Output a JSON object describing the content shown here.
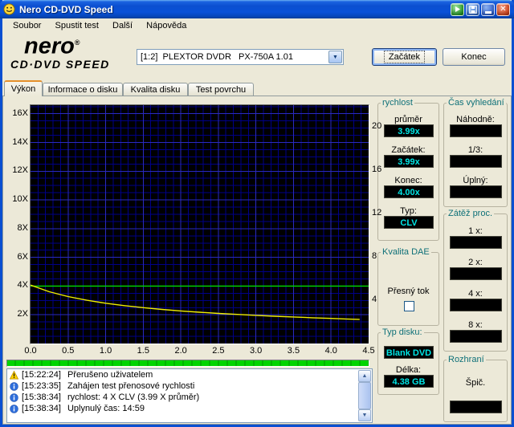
{
  "titlebar": {
    "title": "Nero CD-DVD Speed"
  },
  "icons": {
    "close": "✕",
    "dropdown": "▼",
    "scroll_up": "▲",
    "scroll_down": "▼"
  },
  "menubar": {
    "items": [
      "Soubor",
      "Spustit test",
      "Další",
      "Nápověda"
    ]
  },
  "header": {
    "logo_top": "nero",
    "logo_reg": "®",
    "logo_bottom": "CD·DVD SPEED",
    "drive": "[1:2]  PLEXTOR DVDR   PX-750A 1.01",
    "begin_button": "Začátek",
    "end_button": "Konec"
  },
  "tabs": {
    "items": [
      "Výkon",
      "Informace o disku",
      "Kvalita disku",
      "Test povrchu"
    ],
    "active_index": 0
  },
  "chart_data": {
    "type": "line",
    "xlim": [
      0,
      4.5
    ],
    "x_ticks": [
      "0.0",
      "0.5",
      "1.0",
      "1.5",
      "2.0",
      "2.5",
      "3.0",
      "3.5",
      "4.0",
      "4.5"
    ],
    "left_axis": {
      "max": 16.6,
      "ticks": [
        16,
        14,
        12,
        10,
        8,
        6,
        4,
        2
      ],
      "suffix": "X"
    },
    "right_axis": {
      "max": 22,
      "ticks": [
        20,
        16,
        12,
        8,
        4
      ]
    },
    "grid": {
      "minor_x": 0.1,
      "major_x": 0.5,
      "minor_y": 0.5,
      "major_y": 2,
      "minor_color": "#000088",
      "major_color": "#2a2ac0"
    },
    "background": "#000000",
    "series": [
      {
        "name": "read-speed",
        "axis": "left",
        "color": "#00dc00",
        "x": [
          0,
          4.5
        ],
        "y": [
          4.0,
          4.0
        ]
      },
      {
        "name": "rotation-speed",
        "axis": "right",
        "color": "#f0ee00",
        "x": [
          0,
          0.25,
          0.5,
          0.75,
          1.0,
          1.25,
          1.5,
          1.75,
          2.0,
          2.25,
          2.5,
          2.75,
          3.0,
          3.25,
          3.5,
          3.75,
          4.0,
          4.2,
          4.38
        ],
        "y": [
          5.4,
          4.78,
          4.33,
          3.99,
          3.72,
          3.5,
          3.31,
          3.15,
          3.01,
          2.89,
          2.78,
          2.69,
          2.6,
          2.52,
          2.45,
          2.38,
          2.32,
          2.27,
          2.23
        ]
      }
    ]
  },
  "progress": {
    "percent": 100
  },
  "panels": {
    "speed": {
      "title": "rychlost",
      "rows": [
        {
          "label": "průměr",
          "value": "3.99x"
        },
        {
          "label": "Začátek:",
          "value": "3.99x"
        },
        {
          "label": "Konec:",
          "value": "4.00x"
        },
        {
          "label": "Typ:",
          "value": "CLV"
        }
      ]
    },
    "dae": {
      "title": "Kvalita DAE",
      "stream_label": "Přesný tok"
    },
    "disc": {
      "title": "Typ disku:",
      "type_value": "Blank DVD",
      "length_label": "Délka:",
      "length_value": "4.38 GB"
    },
    "seek": {
      "title": "Čas vyhledání",
      "rows": [
        {
          "label": "Náhodně:",
          "value": ""
        },
        {
          "label": "1/3:",
          "value": ""
        },
        {
          "label": "Úplný:",
          "value": ""
        }
      ]
    },
    "cpu": {
      "title": "Zátěž proc.",
      "rows": [
        {
          "label": "1 x:",
          "value": ""
        },
        {
          "label": "2 x:",
          "value": ""
        },
        {
          "label": "4 x:",
          "value": ""
        },
        {
          "label": "8 x:",
          "value": ""
        }
      ]
    },
    "iface": {
      "title": "Rozhraní",
      "label": "Špič.",
      "value": ""
    }
  },
  "log": {
    "entries": [
      {
        "icon": "warning",
        "time": "[15:22:24]",
        "text": "Přerušeno uživatelem"
      },
      {
        "icon": "info",
        "time": "[15:23:35]",
        "text": "Zahájen test přenosové rychlosti"
      },
      {
        "icon": "info",
        "time": "[15:38:34]",
        "text": "rychlost: 4 X CLV (3.99 X průměr)"
      },
      {
        "icon": "info",
        "time": "[15:38:34]",
        "text": "Uplynulý čas: 14:59"
      }
    ]
  }
}
